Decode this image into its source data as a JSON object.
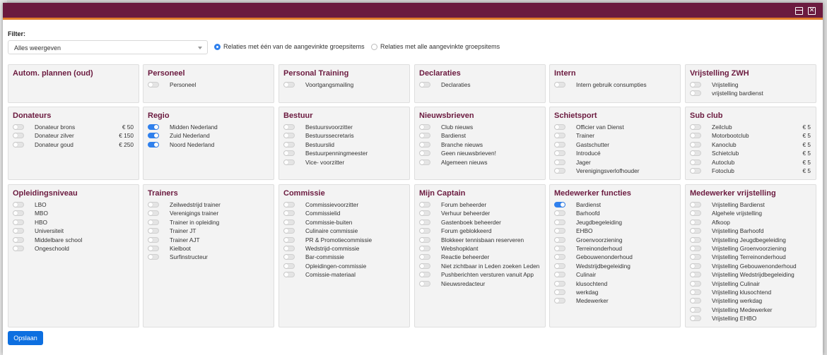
{
  "window": {
    "restore_icon": "restore-icon",
    "close_icon": "close-icon",
    "accent": "#6b1a3f",
    "stripe": "#e07b2a"
  },
  "filter": {
    "label": "Filter:",
    "select_value": "Alles weergeven",
    "radio_any": "Relaties met één van de aangevinkte groepsitems",
    "radio_all": "Relaties met alle aangevinkte groepsitems",
    "selected": "any"
  },
  "groups": [
    {
      "title": "Autom. plannen (oud)",
      "items": []
    },
    {
      "title": "Personeel",
      "items": [
        {
          "label": "Personeel",
          "on": false
        }
      ]
    },
    {
      "title": "Personal Training",
      "items": [
        {
          "label": "Voortgangsmailing",
          "on": false
        }
      ]
    },
    {
      "title": "Declaraties",
      "items": [
        {
          "label": "Declaraties",
          "on": false
        }
      ]
    },
    {
      "title": "Intern",
      "items": [
        {
          "label": "Intern gebruik consumpties",
          "on": false
        }
      ]
    },
    {
      "title": "Vrijstelling ZWH",
      "items": [
        {
          "label": "Vrijstelling",
          "on": false
        },
        {
          "label": "vrijstelling bardienst",
          "on": false
        }
      ]
    },
    {
      "title": "Donateurs",
      "items": [
        {
          "label": "Donateur brons",
          "price": "€ 50",
          "on": false
        },
        {
          "label": "Donateur zilver",
          "price": "€ 150",
          "on": false
        },
        {
          "label": "Donateur goud",
          "price": "€ 250",
          "on": false
        }
      ]
    },
    {
      "title": "Regio",
      "items": [
        {
          "label": "Midden Nederland",
          "on": true
        },
        {
          "label": "Zuid Nederland",
          "on": true
        },
        {
          "label": "Noord Nederland",
          "on": true
        }
      ]
    },
    {
      "title": "Bestuur",
      "items": [
        {
          "label": "Bestuursvoorzitter",
          "on": false
        },
        {
          "label": "Bestuurssecretaris",
          "on": false
        },
        {
          "label": "Bestuurslid",
          "on": false
        },
        {
          "label": "Bestuurpenningmeester",
          "on": false
        },
        {
          "label": "Vice- voorzitter",
          "on": false
        }
      ]
    },
    {
      "title": "Nieuwsbrieven",
      "items": [
        {
          "label": "Club nieuws",
          "on": false
        },
        {
          "label": "Bardienst",
          "on": false
        },
        {
          "label": "Branche nieuws",
          "on": false
        },
        {
          "label": "Geen nieuwsbrieven!",
          "on": false
        },
        {
          "label": "Algemeen nieuws",
          "on": false
        }
      ]
    },
    {
      "title": "Schietsport",
      "items": [
        {
          "label": "Officier van Dienst",
          "on": false
        },
        {
          "label": "Trainer",
          "on": false
        },
        {
          "label": "Gastschutter",
          "on": false
        },
        {
          "label": "Introducé",
          "on": false
        },
        {
          "label": "Jager",
          "on": false
        },
        {
          "label": "Verenigingsverlofhouder",
          "on": false
        }
      ]
    },
    {
      "title": "Sub club",
      "items": [
        {
          "label": "Zeilclub",
          "price": "€ 5",
          "on": false
        },
        {
          "label": "Motorbootclub",
          "price": "€ 5",
          "on": false
        },
        {
          "label": "Kanoclub",
          "price": "€ 5",
          "on": false
        },
        {
          "label": "Schietclub",
          "price": "€ 5",
          "on": false
        },
        {
          "label": "Autoclub",
          "price": "€ 5",
          "on": false
        },
        {
          "label": "Fotoclub",
          "price": "€ 5",
          "on": false
        }
      ]
    },
    {
      "title": "Opleidingsniveau",
      "items": [
        {
          "label": "LBO",
          "on": false
        },
        {
          "label": "MBO",
          "on": false
        },
        {
          "label": "HBO",
          "on": false
        },
        {
          "label": "Universiteit",
          "on": false
        },
        {
          "label": "Middelbare school",
          "on": false
        },
        {
          "label": "Ongeschoold",
          "on": false
        }
      ]
    },
    {
      "title": "Trainers",
      "items": [
        {
          "label": "Zeilwedstrijd trainer",
          "on": false
        },
        {
          "label": "Verenigings trainer",
          "on": false
        },
        {
          "label": "Trainer in opleiding",
          "on": false
        },
        {
          "label": "Trainer JT",
          "on": false
        },
        {
          "label": "Trainer AJT",
          "on": false
        },
        {
          "label": "Kielboot",
          "on": false
        },
        {
          "label": "Surfinstructeur",
          "on": false
        }
      ]
    },
    {
      "title": "Commissie",
      "items": [
        {
          "label": "Commissievoorzitter",
          "on": false
        },
        {
          "label": "Commissielid",
          "on": false
        },
        {
          "label": "Commissie-buiten",
          "on": false
        },
        {
          "label": "Culinaire commissie",
          "on": false
        },
        {
          "label": "PR & Promotiecommissie",
          "on": false
        },
        {
          "label": "Wedstrijd-commissie",
          "on": false
        },
        {
          "label": "Bar-commissie",
          "on": false
        },
        {
          "label": "Opleidingen-commissie",
          "on": false
        },
        {
          "label": "Comissie-materiaal",
          "on": false
        }
      ]
    },
    {
      "title": "Mijn Captain",
      "items": [
        {
          "label": "Forum beheerder",
          "on": false
        },
        {
          "label": "Verhuur beheerder",
          "on": false
        },
        {
          "label": "Gastenboek beheerder",
          "on": false
        },
        {
          "label": "Forum geblokkeerd",
          "on": false
        },
        {
          "label": "Blokkeer tennisbaan reserveren",
          "on": false
        },
        {
          "label": "Webshopklant",
          "on": false
        },
        {
          "label": "Reactie beheerder",
          "on": false
        },
        {
          "label": "Niet zichtbaar in Leden zoeken Leden",
          "on": false
        },
        {
          "label": "Pushberichten versturen vanuit App",
          "on": false
        },
        {
          "label": "Nieuwsredacteur",
          "on": false
        }
      ]
    },
    {
      "title": "Medewerker functies",
      "items": [
        {
          "label": "Bardienst",
          "on": true
        },
        {
          "label": "Barhoofd",
          "on": false
        },
        {
          "label": "Jeugdbegeleiding",
          "on": false
        },
        {
          "label": "EHBO",
          "on": false
        },
        {
          "label": "Groenvoorziening",
          "on": false
        },
        {
          "label": "Terreinonderhoud",
          "on": false
        },
        {
          "label": "Gebouwenonderhoud",
          "on": false
        },
        {
          "label": "Wedstrijdbegeleiding",
          "on": false
        },
        {
          "label": "Culinair",
          "on": false
        },
        {
          "label": "klusochtend",
          "on": false
        },
        {
          "label": "werkdag",
          "on": false
        },
        {
          "label": "Medewerker",
          "on": false
        }
      ]
    },
    {
      "title": "Medewerker vrijstelling",
      "items": [
        {
          "label": "Vrijstelling Bardienst",
          "on": false
        },
        {
          "label": "Algehele vrijstelling",
          "on": false
        },
        {
          "label": "Afkoop",
          "on": false
        },
        {
          "label": "Vrijstelling Barhoofd",
          "on": false
        },
        {
          "label": "Vrijstelling Jeugdbegeleiding",
          "on": false
        },
        {
          "label": "Vrijstelling Groenvoorziening",
          "on": false
        },
        {
          "label": "Vrijstelling Terreinonderhoud",
          "on": false
        },
        {
          "label": "Vrijstelling Gebouwenonderhoud",
          "on": false
        },
        {
          "label": "Vrijstelling Wedstrijdbegeleiding",
          "on": false
        },
        {
          "label": "Vrijstelling Culinair",
          "on": false
        },
        {
          "label": "Vrijstelling klusochtend",
          "on": false
        },
        {
          "label": "Vrijstelling werkdag",
          "on": false
        },
        {
          "label": "Vrijstelling Medewerker",
          "on": false
        },
        {
          "label": "Vrijstelling EHBO",
          "on": false
        }
      ]
    }
  ],
  "save_label": "Opslaan"
}
